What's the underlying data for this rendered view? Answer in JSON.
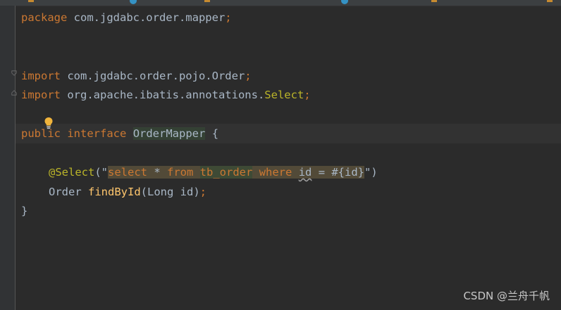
{
  "editor": {
    "lines": {
      "package_kw": "package",
      "package_name": " com.jgdabc.order.mapper",
      "semi": ";",
      "import1_kw": "import",
      "import1_path": " com.jgdabc.order.pojo.Order",
      "import2_kw": "import",
      "import2_path": " org.apache.ibatis.annotations.",
      "import2_cls": "Select",
      "public_kw": "public",
      "interface_kw": "interface",
      "iface_name": "OrderMapper",
      "open_brace": "{",
      "ann_at": "@Select",
      "paren_open": "(\"",
      "sql_select": "select",
      "sql_star": " * ",
      "sql_from": "from",
      "sql_table": "tb_order",
      "sql_where": "where",
      "sql_id": "id",
      "sql_eq": " = #{id}",
      "paren_close": "\")",
      "ret_type": "Order",
      "method": "findById",
      "params": "(Long id)",
      "close_brace": "}"
    }
  },
  "watermark": "CSDN @兰舟千帆",
  "icons": {
    "intention": "lightbulb-icon",
    "fold": "fold-marker-icon"
  },
  "colors": {
    "background": "#2b2b2b",
    "keyword": "#cc7832",
    "annotation": "#bbb529",
    "method": "#ffc66d",
    "string": "#6a8759",
    "text": "#a9b7c6"
  }
}
